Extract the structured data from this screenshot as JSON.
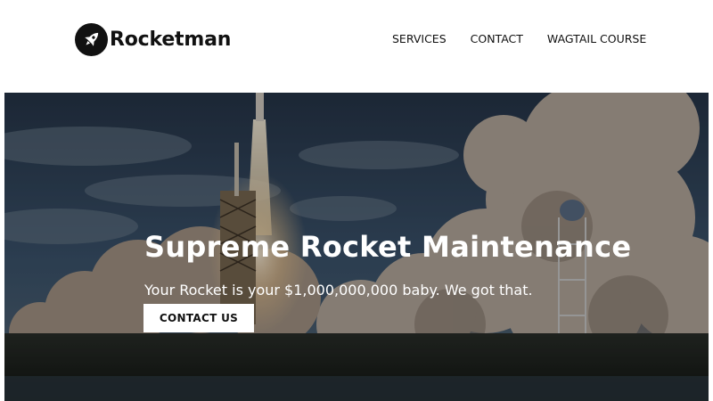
{
  "brand": {
    "name": "Rocketman",
    "logo_icon": "rocket-icon"
  },
  "nav": {
    "links": [
      {
        "label": "SERVICES"
      },
      {
        "label": "CONTACT"
      },
      {
        "label": "WAGTAIL COURSE"
      }
    ]
  },
  "hero": {
    "title": "Supreme Rocket Maintenance",
    "subtitle": "Your Rocket is your $1,000,000,000 baby. We got that.",
    "button_label": "CONTACT US",
    "background": "rocket-launch-photo"
  },
  "colors": {
    "text_dark": "#111111",
    "hero_text": "#ffffff",
    "button_bg": "#ffffff"
  }
}
